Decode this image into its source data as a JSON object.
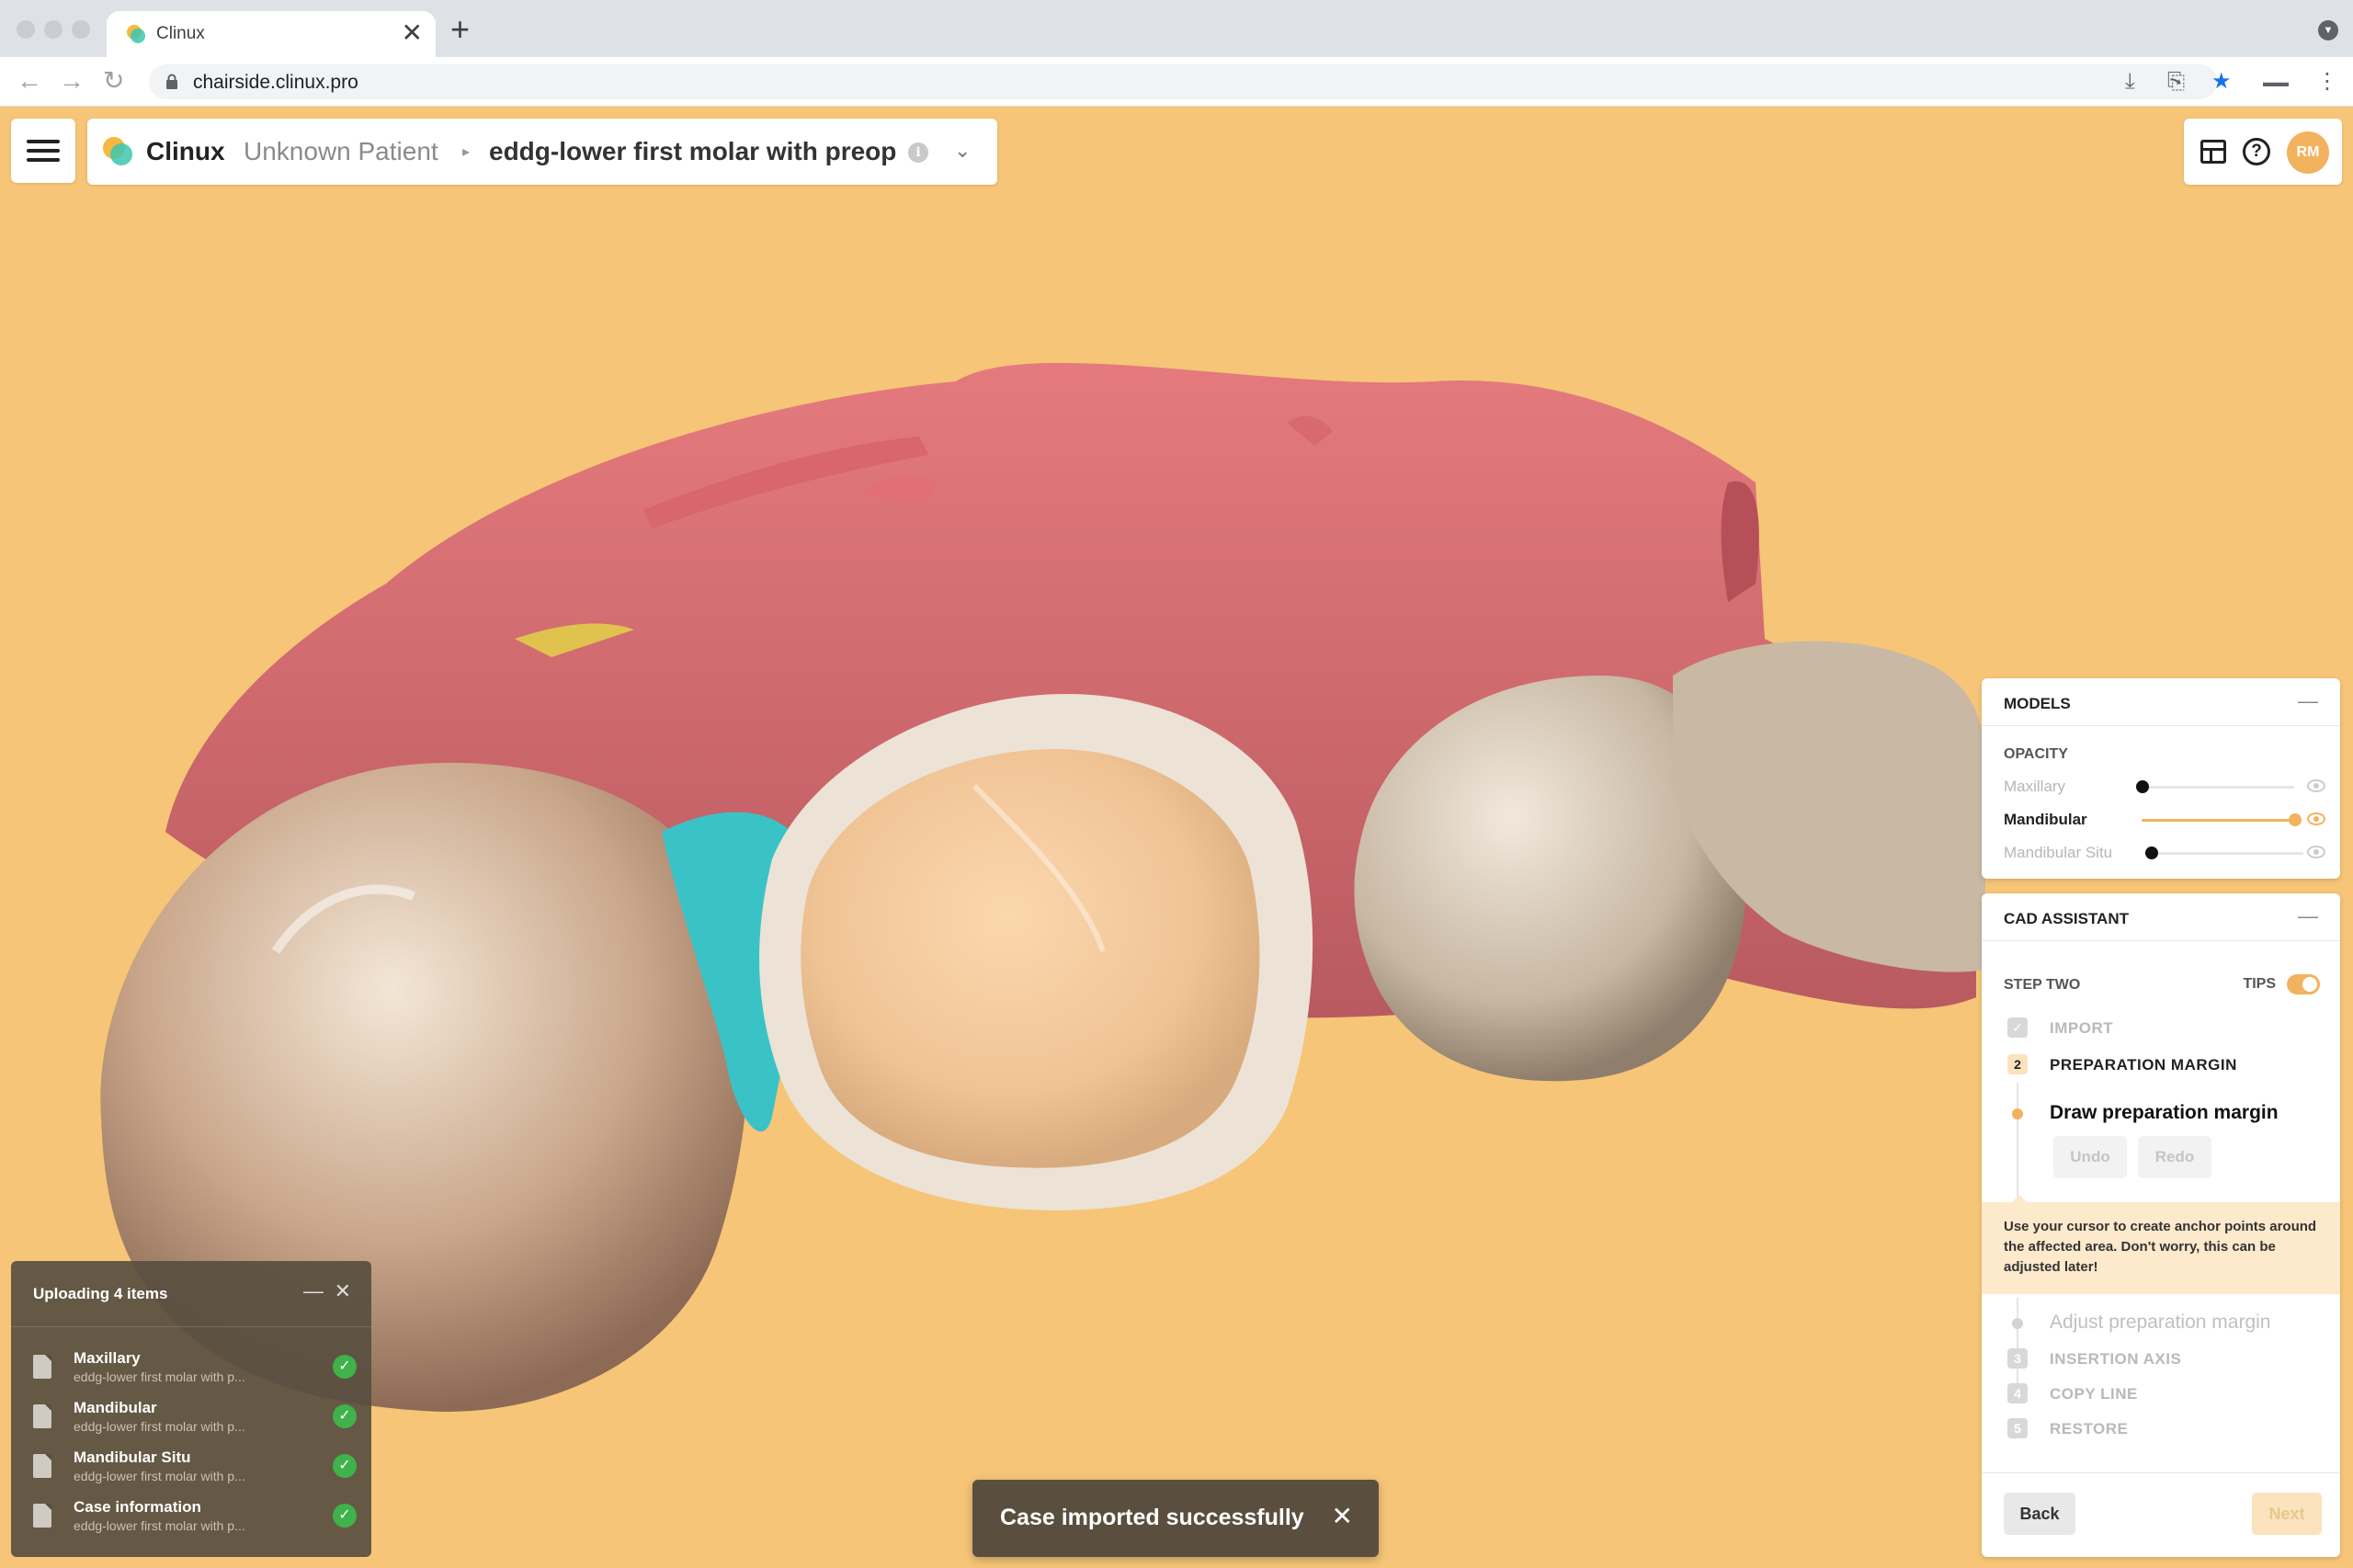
{
  "browser": {
    "tab_title": "Clinux",
    "tab_close": "✕",
    "new_tab": "+",
    "url": "chairside.clinux.pro",
    "back": "←",
    "forward": "→",
    "reload": "↻"
  },
  "header": {
    "brand": "Clinux",
    "patient": "Unknown Patient",
    "separator": "▸",
    "case_name": "eddg-lower first molar with preop",
    "info": "i",
    "dropdown": "⌄",
    "help": "?",
    "avatar_initials": "RM"
  },
  "models": {
    "title": "MODELS",
    "minimize": "—",
    "opacity_label": "OPACITY",
    "layers": [
      {
        "name": "Maxillary",
        "opacity": 0,
        "active": false
      },
      {
        "name": "Mandibular",
        "opacity": 1,
        "active": true
      },
      {
        "name": "Mandibular Situ",
        "opacity": 0,
        "active": false
      }
    ]
  },
  "cad": {
    "title": "CAD ASSISTANT",
    "minimize": "—",
    "step_heading": "STEP TWO",
    "tips_label": "TIPS",
    "tips_enabled": true,
    "steps": [
      {
        "badge": "✓",
        "label": "IMPORT"
      },
      {
        "badge": "2",
        "label": "PREPARATION MARGIN"
      },
      {
        "badge": "3",
        "label": "INSERTION AXIS"
      },
      {
        "badge": "4",
        "label": "COPY LINE"
      },
      {
        "badge": "5",
        "label": "RESTORE"
      }
    ],
    "substeps": [
      {
        "label": "Draw preparation margin"
      },
      {
        "label": "Adjust preparation margin"
      }
    ],
    "undo": "Undo",
    "redo": "Redo",
    "tip": "Use your cursor to create anchor points around the affected area. Don't worry, this can be adjusted later!",
    "back": "Back",
    "next": "Next"
  },
  "upload": {
    "title": "Uploading 4 items",
    "minimize": "—",
    "close": "✕",
    "items": [
      {
        "name": "Maxillary",
        "sub": "eddg-lower first molar with p..."
      },
      {
        "name": "Mandibular",
        "sub": "eddg-lower first molar with p..."
      },
      {
        "name": "Mandibular Situ",
        "sub": "eddg-lower first molar with p..."
      },
      {
        "name": "Case information",
        "sub": "eddg-lower first molar with p..."
      }
    ],
    "check": "✓"
  },
  "toast": {
    "message": "Case imported successfully",
    "close": "✕"
  },
  "colors": {
    "background": "#f6c577",
    "accent": "#f3b25e",
    "gum": "#d9706f",
    "tooth": "#e8d6c0",
    "prep": "#f4c99a",
    "highlight": "#3ac3c7",
    "success": "#3fb24a"
  }
}
